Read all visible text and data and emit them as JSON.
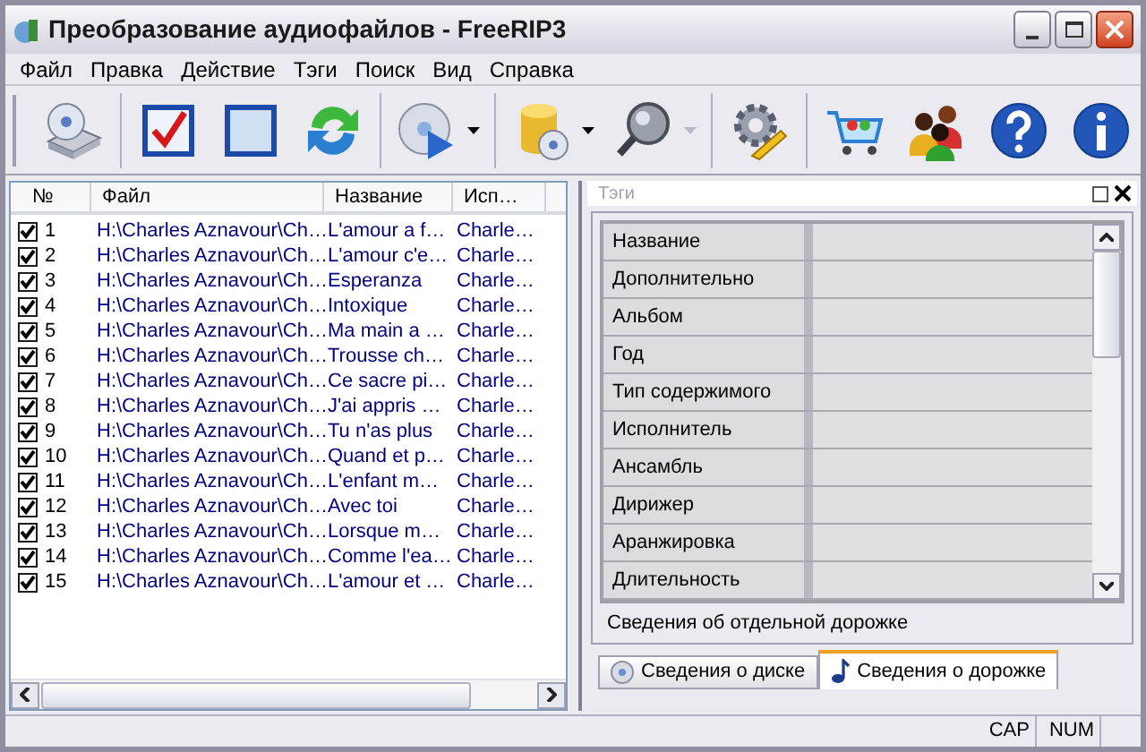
{
  "window": {
    "title": "Преобразование аудиофайлов - FreeRIP3"
  },
  "menu": [
    "Файл",
    "Правка",
    "Действие",
    "Тэги",
    "Поиск",
    "Вид",
    "Справка"
  ],
  "toolbar": [
    {
      "kind": "drive",
      "has_menu": false,
      "disabled": false
    },
    {
      "kind": "check_all",
      "has_menu": false,
      "disabled": false
    },
    {
      "kind": "uncheck_all",
      "has_menu": false,
      "disabled": false
    },
    {
      "kind": "refresh",
      "has_menu": false,
      "disabled": false
    },
    {
      "kind": "play",
      "has_menu": true,
      "disabled": false
    },
    {
      "kind": "database",
      "has_menu": true,
      "disabled": false
    },
    {
      "kind": "search",
      "has_menu": true,
      "disabled": true
    },
    {
      "kind": "settings",
      "has_menu": false,
      "disabled": false
    },
    {
      "kind": "cart",
      "has_menu": false,
      "disabled": false
    },
    {
      "kind": "users",
      "has_menu": false,
      "disabled": false
    },
    {
      "kind": "help",
      "has_menu": false,
      "disabled": false
    },
    {
      "kind": "info",
      "has_menu": false,
      "disabled": false
    }
  ],
  "table": {
    "columns": [
      "№",
      "Файл",
      "Название",
      "Исп…"
    ],
    "rows": [
      {
        "checked": true,
        "no": "1",
        "file": "H:\\Charles Aznavour\\Ch…",
        "title": "L'amour a f…",
        "artist": "Charle…"
      },
      {
        "checked": true,
        "no": "2",
        "file": "H:\\Charles Aznavour\\Ch…",
        "title": "L'amour c'e…",
        "artist": "Charle…"
      },
      {
        "checked": true,
        "no": "3",
        "file": "H:\\Charles Aznavour\\Ch…",
        "title": "Esperanza",
        "artist": "Charle…"
      },
      {
        "checked": true,
        "no": "4",
        "file": "H:\\Charles Aznavour\\Ch…",
        "title": "Intoxique",
        "artist": "Charle…"
      },
      {
        "checked": true,
        "no": "5",
        "file": "H:\\Charles Aznavour\\Ch…",
        "title": "Ma main a …",
        "artist": "Charle…"
      },
      {
        "checked": true,
        "no": "6",
        "file": "H:\\Charles Aznavour\\Ch…",
        "title": "Trousse ch…",
        "artist": "Charle…"
      },
      {
        "checked": true,
        "no": "7",
        "file": "H:\\Charles Aznavour\\Ch…",
        "title": "Ce sacre pi…",
        "artist": "Charle…"
      },
      {
        "checked": true,
        "no": "8",
        "file": "H:\\Charles Aznavour\\Ch…",
        "title": "J'ai appris …",
        "artist": "Charle…"
      },
      {
        "checked": true,
        "no": "9",
        "file": "H:\\Charles Aznavour\\Ch…",
        "title": "Tu n'as plus",
        "artist": "Charle…"
      },
      {
        "checked": true,
        "no": "10",
        "file": "H:\\Charles Aznavour\\Ch…",
        "title": "Quand et p…",
        "artist": "Charle…"
      },
      {
        "checked": true,
        "no": "11",
        "file": "H:\\Charles Aznavour\\Ch…",
        "title": "L'enfant m…",
        "artist": "Charle…"
      },
      {
        "checked": true,
        "no": "12",
        "file": "H:\\Charles Aznavour\\Ch…",
        "title": "Avec toi",
        "artist": "Charle…"
      },
      {
        "checked": true,
        "no": "13",
        "file": "H:\\Charles Aznavour\\Ch…",
        "title": "Lorsque m…",
        "artist": "Charle…"
      },
      {
        "checked": true,
        "no": "14",
        "file": "H:\\Charles Aznavour\\Ch…",
        "title": "Comme l'ea…",
        "artist": "Charle…"
      },
      {
        "checked": true,
        "no": "15",
        "file": "H:\\Charles Aznavour\\Ch…",
        "title": "L'amour et …",
        "artist": "Charle…"
      }
    ]
  },
  "tags_panel": {
    "title": "Тэги",
    "fields": [
      "Название",
      "Дополнительно",
      "Альбом",
      "Год",
      "Тип содержимого",
      "Исполнитель",
      "Ансамбль",
      "Дирижер",
      "Аранжировка",
      "Длительность"
    ],
    "description": "Сведения об отдельной дорожке",
    "tabs": [
      {
        "label": "Сведения о диске",
        "kind": "disc",
        "selected": false
      },
      {
        "label": "Сведения о дорожке",
        "kind": "note",
        "selected": true
      }
    ]
  },
  "status_bar": [
    "CAP",
    "NUM"
  ]
}
